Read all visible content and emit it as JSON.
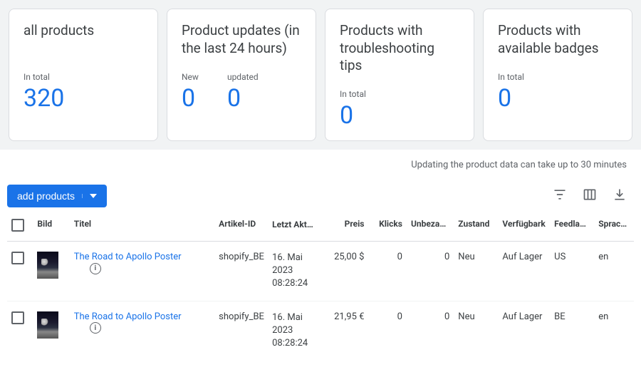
{
  "cards": [
    {
      "title": "all products",
      "metrics": [
        {
          "label": "In total",
          "value": "320"
        }
      ]
    },
    {
      "title": "Product updates (in the last 24 hours)",
      "metrics": [
        {
          "label": "New",
          "value": "0"
        },
        {
          "label": "updated",
          "value": "0"
        }
      ]
    },
    {
      "title": "Products with troubleshooting tips",
      "metrics": [
        {
          "label": "In total",
          "value": "0"
        }
      ]
    },
    {
      "title": "Products with available badges",
      "metrics": [
        {
          "label": "In total",
          "value": "0"
        }
      ]
    }
  ],
  "notice": "Updating the product data can take up to 30 minutes",
  "toolbar": {
    "add_label": "add products"
  },
  "columns": {
    "image": "Bild",
    "title": "Titel",
    "article": "Artikel-ID",
    "updated": "Letzt Aktu",
    "price": "Preis",
    "clicks": "Klicks",
    "unpaid": "Unbezahl Klicks",
    "status": "Zustand",
    "availability": "Verfügbark",
    "feedlabel": "Feedlabel",
    "language": "Sprache"
  },
  "rows": [
    {
      "title": "The Road to Apollo Poster",
      "article": "shopify_BE",
      "updated": "16. Mai 2023 08:28:24",
      "price": "25,00 $",
      "clicks": "0",
      "unpaid": "0",
      "status": "Neu",
      "availability": "Auf Lager",
      "feedlabel": "US",
      "language": "en"
    },
    {
      "title": "The Road to Apollo Poster",
      "article": "shopify_BE",
      "updated": "16. Mai 2023 08:28:24",
      "price": "21,95 €",
      "clicks": "0",
      "unpaid": "0",
      "status": "Neu",
      "availability": "Auf Lager",
      "feedlabel": "BE",
      "language": "en"
    }
  ]
}
